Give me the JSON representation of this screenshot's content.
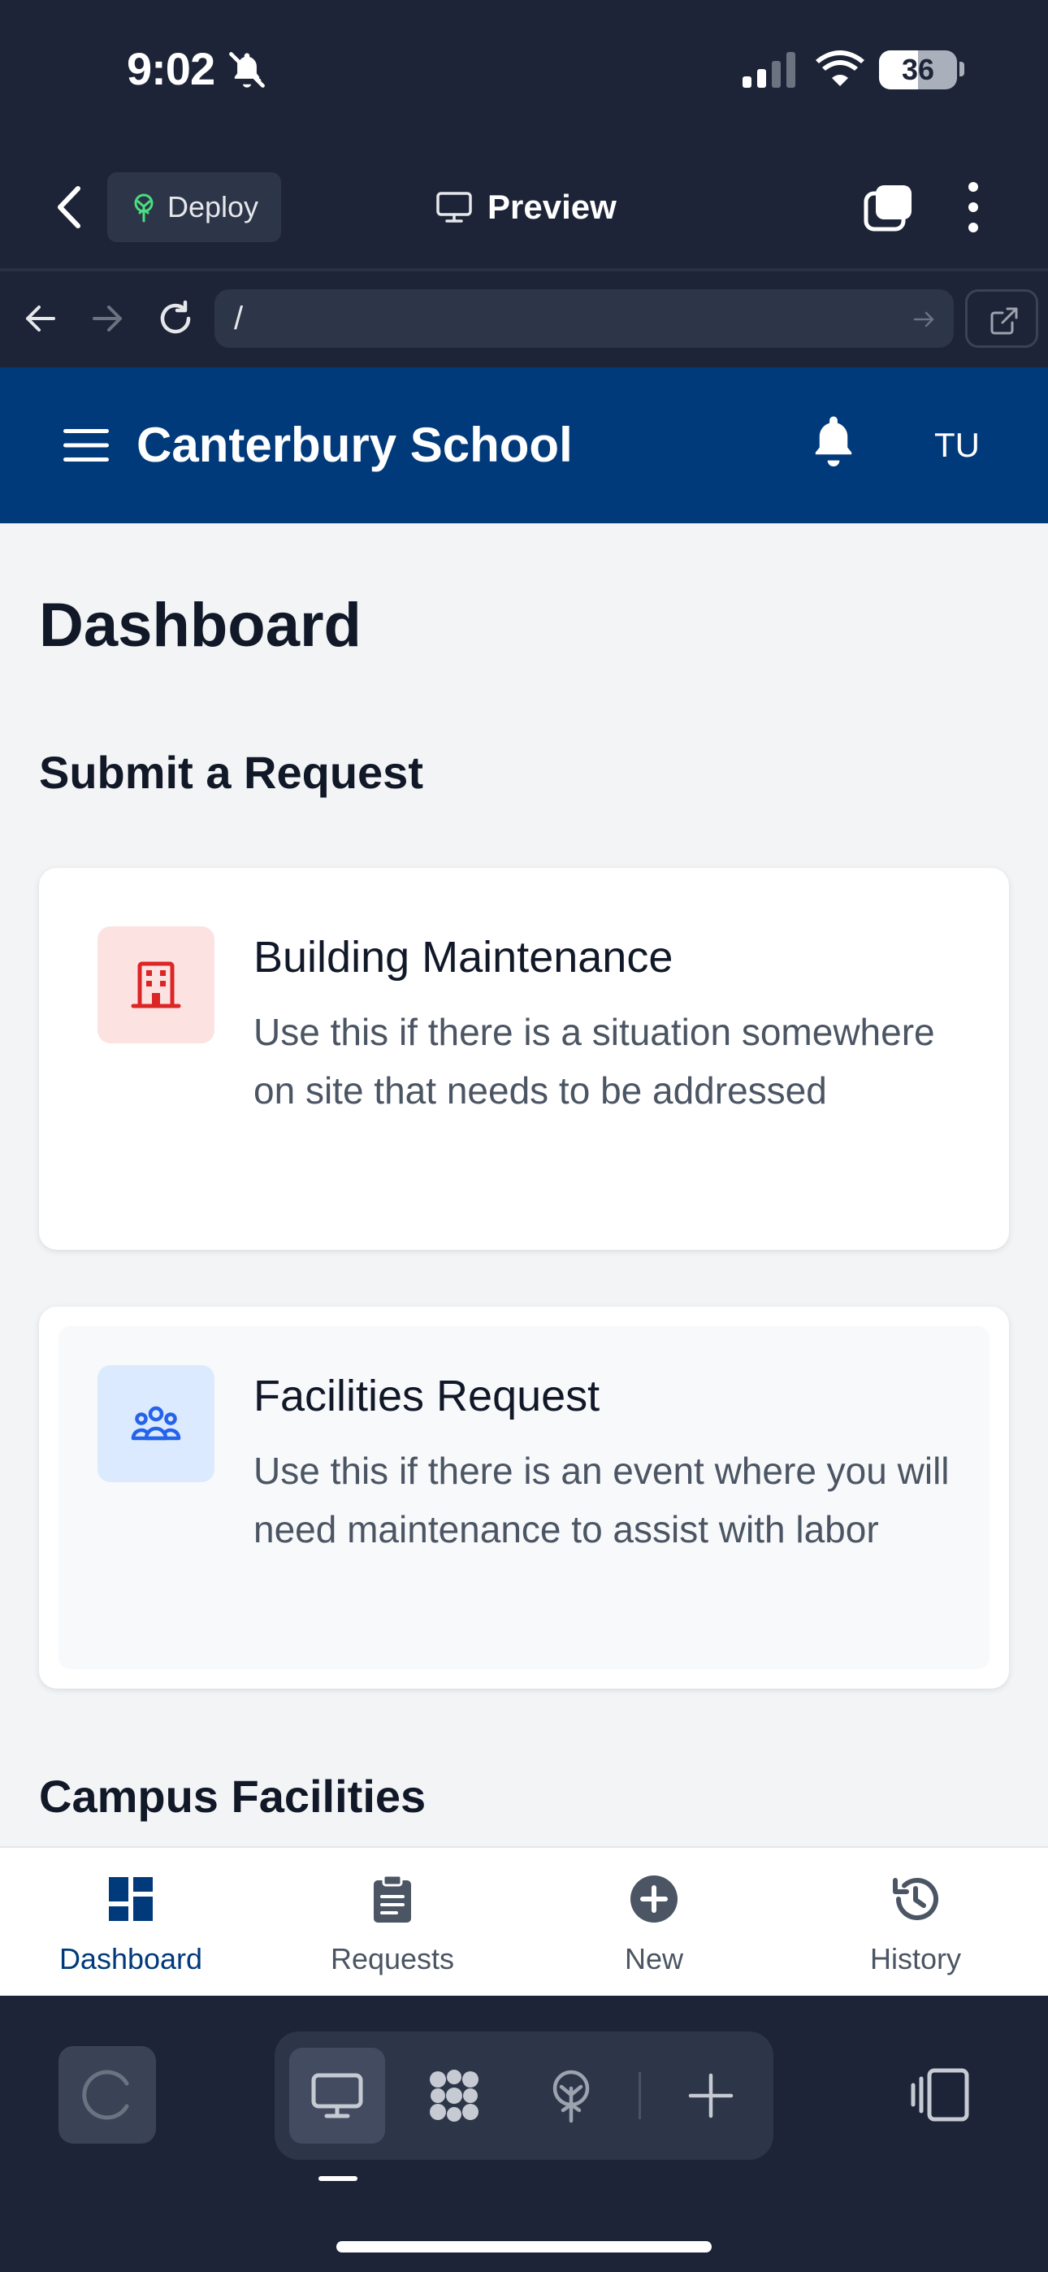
{
  "status_bar": {
    "time": "9:02",
    "battery": "36"
  },
  "header": {
    "deploy_label": "Deploy",
    "preview_label": "Preview"
  },
  "url_bar": {
    "url": "/"
  },
  "site": {
    "name": "Canterbury School",
    "user_initials": "TU"
  },
  "page": {
    "title": "Dashboard",
    "submit_section": "Submit a Request",
    "campus_section": "Campus Facilities",
    "cards": [
      {
        "title": "Building Maintenance",
        "description": "Use this if there is a situation somewhere on site that needs to be addressed",
        "icon": "building-icon",
        "accent": "#dc2626"
      },
      {
        "title": "Facilities Request",
        "description": "Use this if there is an event where you will need maintenance to assist with labor",
        "icon": "users-group-icon",
        "accent": "#2563eb"
      }
    ]
  },
  "tabbar": {
    "items": [
      {
        "label": "Dashboard",
        "icon": "dashboard-icon",
        "active": true
      },
      {
        "label": "Requests",
        "icon": "clipboard-icon",
        "active": false
      },
      {
        "label": "New",
        "icon": "plus-circle-icon",
        "active": false
      },
      {
        "label": "History",
        "icon": "history-icon",
        "active": false
      }
    ]
  },
  "colors": {
    "brand": "#013a7b",
    "chrome": "#1d2437",
    "background": "#f3f4f6"
  }
}
